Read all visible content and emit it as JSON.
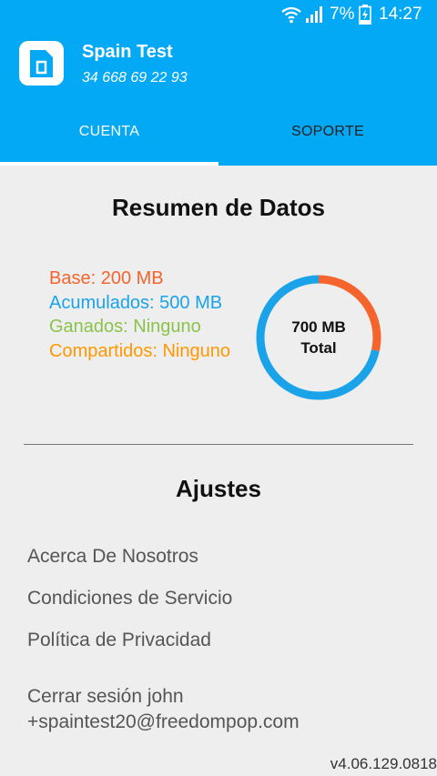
{
  "status_bar": {
    "battery_percent": "7%",
    "time": "14:27",
    "icons": [
      "wifi-icon",
      "signal-icon",
      "battery-charging-icon"
    ]
  },
  "header": {
    "account_name": "Spain Test",
    "phone": "34 668 69 22 93",
    "app_icon": "sim-card-icon"
  },
  "tabs": [
    {
      "label": "CUENTA",
      "active": true
    },
    {
      "label": "SOPORTE",
      "active": false
    }
  ],
  "data_summary": {
    "title": "Resumen de Datos",
    "legend": [
      {
        "text": "Base: 200 MB",
        "color": "#f5642c"
      },
      {
        "text": "Acumulados: 500 MB",
        "color": "#1aa3e8"
      },
      {
        "text": "Ganados: Ninguno",
        "color": "#8bc34a"
      },
      {
        "text": "Compartidos: Ninguno",
        "color": "#ff9800"
      }
    ],
    "total_value": "700 MB",
    "total_label": "Total"
  },
  "chart_data": {
    "type": "pie",
    "style": "donut",
    "categories": [
      "Base",
      "Acumulados"
    ],
    "values": [
      200,
      500
    ],
    "colors": [
      "#f5642c",
      "#1aa3e8"
    ]
  },
  "settings": {
    "title": "Ajustes",
    "items": [
      "Acerca De Nosotros",
      "Condiciones de Servicio",
      "Política de Privacidad"
    ],
    "logout": "Cerrar sesión john +spaintest20@freedompop.com"
  },
  "version": "v4.06.129.0818",
  "colors": {
    "primary": "#03a9f4",
    "background": "#eeeeee"
  }
}
